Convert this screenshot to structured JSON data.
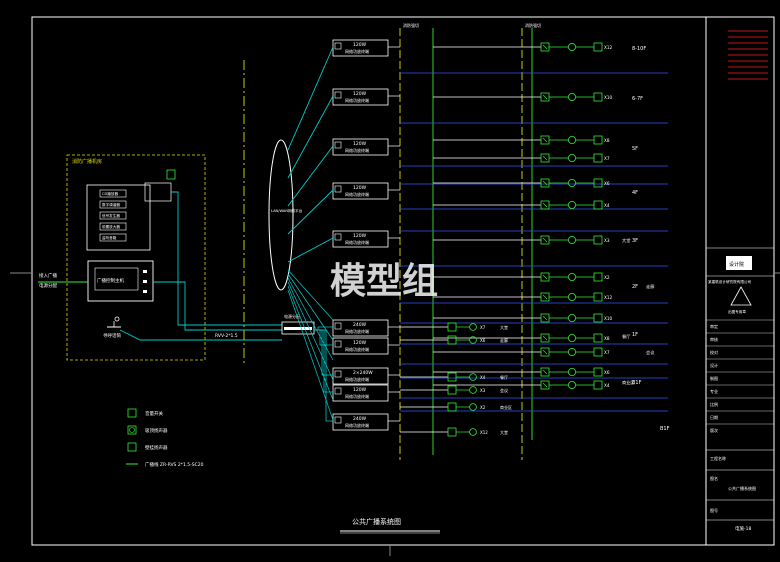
{
  "drawing": {
    "title": "公共广播系统图",
    "watermark": "模型组",
    "bg_color": "#000000",
    "frame_color": "#ffffff",
    "cyan": "#00cccc",
    "green": "#33ee33",
    "yellow": "#dddd00",
    "blue": "#3355ff",
    "red": "#ff2222"
  },
  "machine_room": {
    "title": "消防广播机房",
    "host_label": "广播控制主机",
    "input_note": "接入广播",
    "devices": [
      "CD播放器",
      "数字调谐器",
      "信号发生器",
      "前置放大器",
      "监听音箱"
    ],
    "mic_label": "寻呼话筒",
    "cable_label": "RVV-2*1.5",
    "pwr_label": "电源分配"
  },
  "legend": [
    {
      "label": "音量开关"
    },
    {
      "label": "吸顶扬声器"
    },
    {
      "label": "壁挂扬声器"
    },
    {
      "label": "广播线  ZR-RVS 2*1.5-SC20"
    }
  ],
  "network": {
    "label": "LAN/WAN网络平台"
  },
  "amplifiers": [
    "120W",
    "120W",
    "120W",
    "120W",
    "120W",
    "240W",
    "120W",
    "2×240W",
    "120W",
    "240W"
  ],
  "amp_sub": "网络功放终端",
  "column_labels": [
    "消防强切",
    "消防强切"
  ],
  "floors": [
    "8-10F",
    "6-7F",
    "5F",
    "4F",
    "3F",
    "2F",
    "1F",
    "B1F"
  ],
  "floor_zones": [
    "大堂",
    "走廊",
    "餐厅",
    "会议",
    "商业区"
  ],
  "speaker_counts": [
    "X12",
    "X10",
    "X8",
    "X7",
    "X6",
    "X4",
    "X3",
    "X2"
  ],
  "title_block": {
    "company": "某建筑设计研究院有限公司",
    "logo_text": "设计院",
    "stamp_text": "出图专用章",
    "project_label": "工程名称",
    "drawing_label": "图名",
    "drawing_name": "公共广播系统图",
    "number_label": "图号",
    "number_value": "电施-18",
    "rows": [
      "审定",
      "审核",
      "校对",
      "设计",
      "制图",
      "专业",
      "比例",
      "日期",
      "版次"
    ]
  }
}
